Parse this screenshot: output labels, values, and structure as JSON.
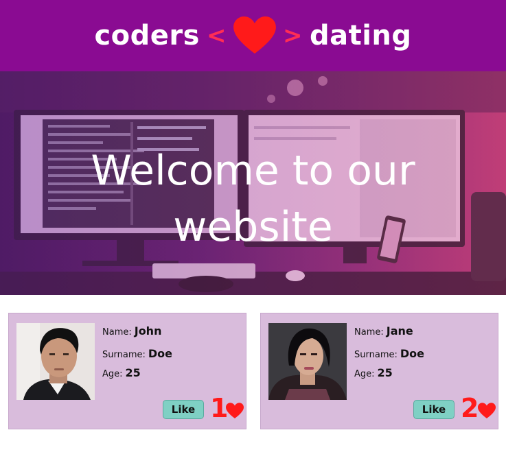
{
  "header": {
    "left_word": "coders",
    "left_angle": "<",
    "right_angle": ">",
    "right_word": "dating"
  },
  "hero": {
    "title_line1": "Welcome to our",
    "title_line2": "website"
  },
  "profiles": [
    {
      "name_label": "Name:",
      "name": "John",
      "surname_label": "Surname:",
      "surname": "Doe",
      "age_label": "Age:",
      "age": "25",
      "like_label": "Like",
      "likes": "1"
    },
    {
      "name_label": "Name:",
      "name": "Jane",
      "surname_label": "Surname:",
      "surname": "Doe",
      "age_label": "Age:",
      "age": "25",
      "like_label": "Like",
      "likes": "2"
    }
  ],
  "colors": {
    "header_bg": "#8a0b92",
    "heart": "#ff1a1a",
    "card_bg": "#d9bcdc",
    "like_button": "#7fd0c4"
  }
}
